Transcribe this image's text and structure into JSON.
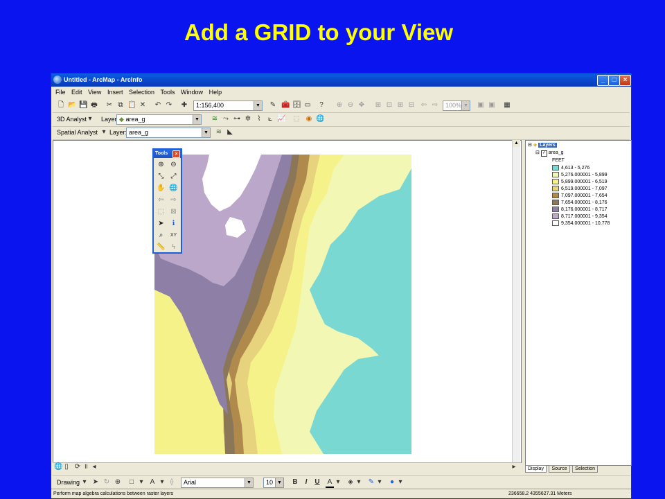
{
  "slide_title": "Add a GRID to your View",
  "window": {
    "title": "Untitled - ArcMap - ArcInfo",
    "menus": [
      "File",
      "Edit",
      "View",
      "Insert",
      "Selection",
      "Tools",
      "Window",
      "Help"
    ]
  },
  "toolbar": {
    "scale_value": "1:156,400",
    "zoom_value": "100%",
    "analyst3d_label": "3D Analyst",
    "analyst3d_layer_label": "Layer:",
    "analyst3d_layer_value": "area_g",
    "spatial_label": "Spatial Analyst",
    "spatial_layer_label": "Layer:",
    "spatial_layer_value": "area_g"
  },
  "tools_window": {
    "title": "Tools"
  },
  "toc": {
    "root_label": "Layers",
    "layer_label": "area_g",
    "units_label": "FEET",
    "classes": [
      {
        "label": "4,613 - 5,276",
        "color": "#7ad8d2"
      },
      {
        "label": "5,276.000001 - 5,899",
        "color": "#f3f7b4"
      },
      {
        "label": "5,899.000001 - 6,519",
        "color": "#f5f28a"
      },
      {
        "label": "6,519.000001 - 7,097",
        "color": "#e7d37e"
      },
      {
        "label": "7,097.000001 - 7,654",
        "color": "#b08a4c"
      },
      {
        "label": "7,654.000001 - 8,176",
        "color": "#8c7658"
      },
      {
        "label": "8,176.000001 - 8,717",
        "color": "#8d7fa6"
      },
      {
        "label": "8,717.000001 - 9,354",
        "color": "#bba7c9"
      },
      {
        "label": "9,354.000001 - 10,778",
        "color": "#ffffff"
      }
    ],
    "tabs": [
      "Display",
      "Source",
      "Selection"
    ]
  },
  "drawing": {
    "drawing_label": "Drawing",
    "font_name": "Arial",
    "font_size": "10",
    "bold": "B",
    "italic": "I",
    "underline": "U"
  },
  "status": {
    "message": "Perform map algebra calculations between raster layers",
    "coords": "236658.2  4355627.31 Meters"
  }
}
